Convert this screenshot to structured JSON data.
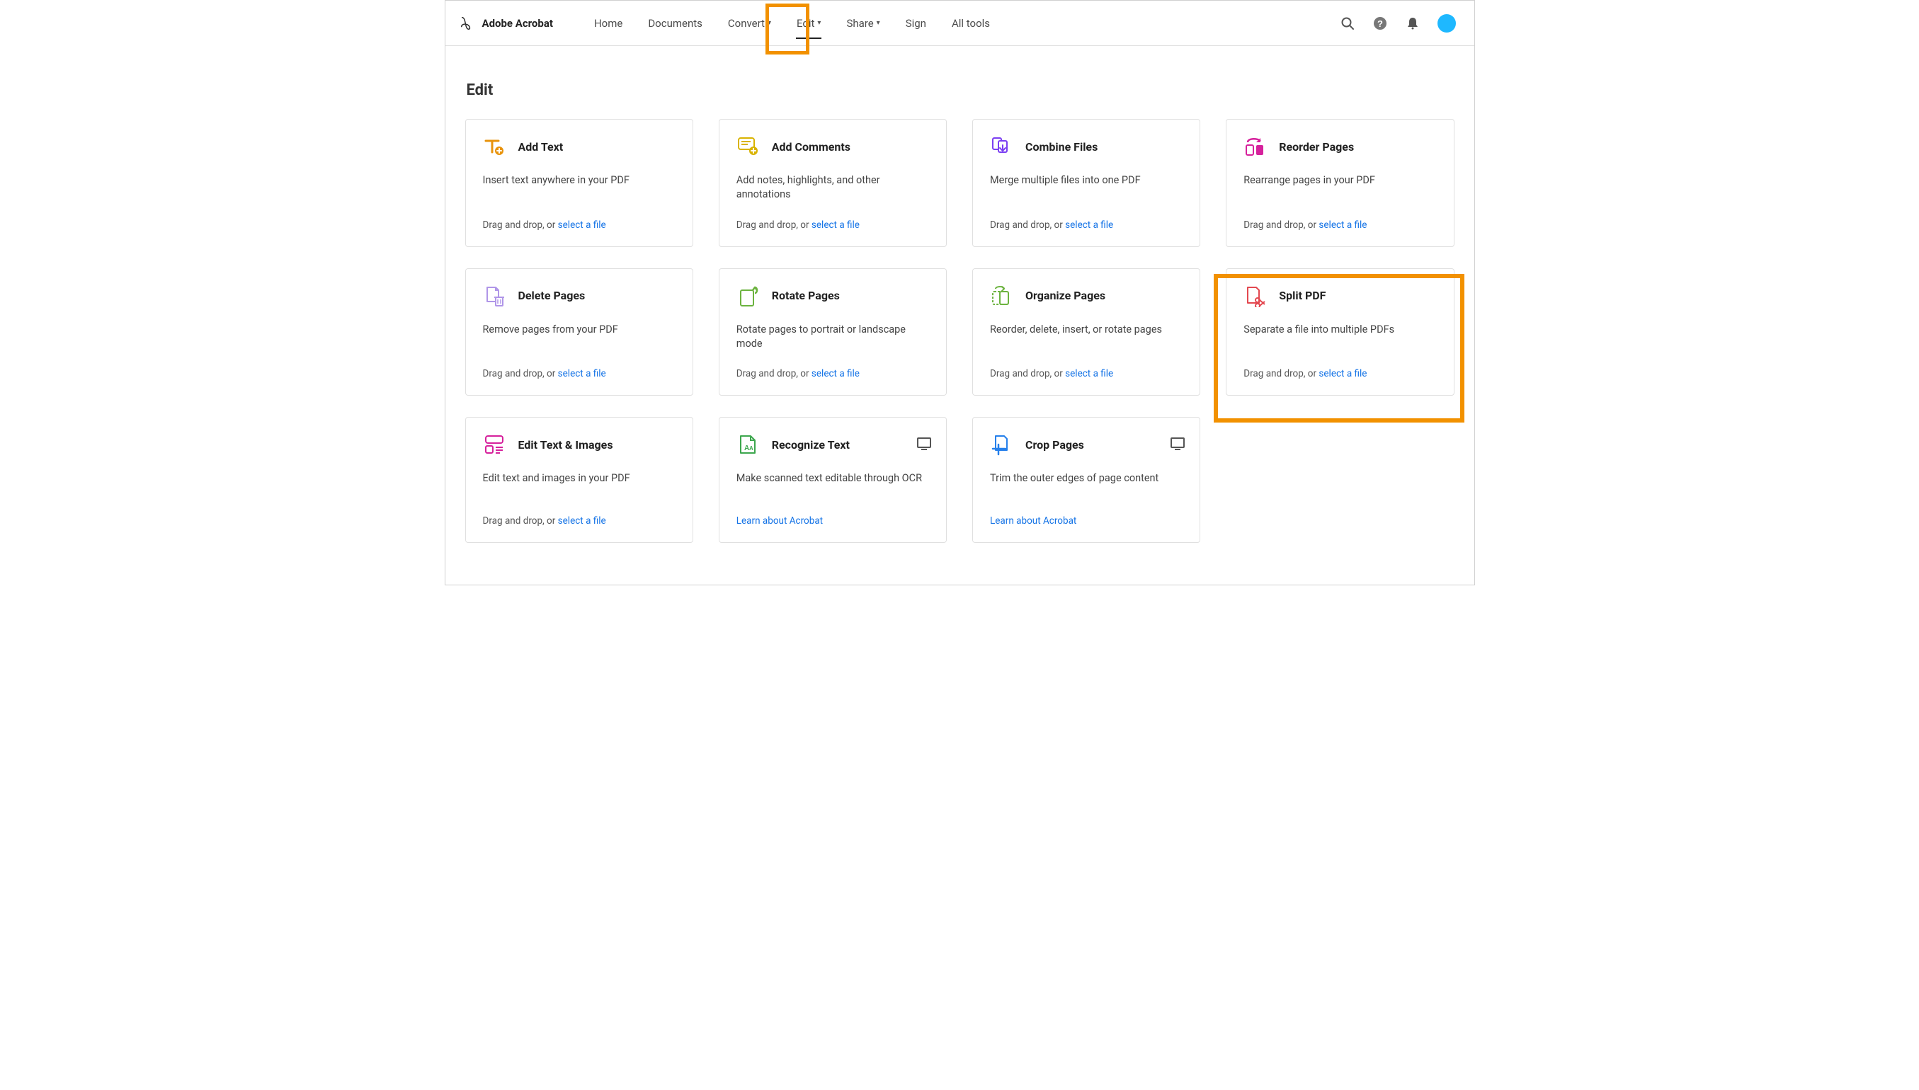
{
  "brand": "Adobe Acrobat",
  "nav": {
    "home": "Home",
    "documents": "Documents",
    "convert": "Convert",
    "edit": "Edit",
    "share": "Share",
    "sign": "Sign",
    "all_tools": "All tools"
  },
  "page_title": "Edit",
  "drop_prefix": "Drag and drop, or ",
  "select_file": "select a file",
  "learn_link": "Learn about Acrobat",
  "cards": {
    "add_text": {
      "title": "Add Text",
      "desc": "Insert text anywhere in your PDF"
    },
    "add_comments": {
      "title": "Add Comments",
      "desc": "Add notes, highlights, and other annotations"
    },
    "combine": {
      "title": "Combine Files",
      "desc": "Merge multiple files into one PDF"
    },
    "reorder": {
      "title": "Reorder Pages",
      "desc": "Rearrange pages in your PDF"
    },
    "delete": {
      "title": "Delete Pages",
      "desc": "Remove pages from your PDF"
    },
    "rotate": {
      "title": "Rotate Pages",
      "desc": "Rotate pages to portrait or landscape mode"
    },
    "organize": {
      "title": "Organize Pages",
      "desc": "Reorder, delete, insert, or rotate pages"
    },
    "split": {
      "title": "Split PDF",
      "desc": "Separate a file into multiple PDFs"
    },
    "edit_ti": {
      "title": "Edit Text & Images",
      "desc": "Edit text and images in your PDF"
    },
    "recognize": {
      "title": "Recognize Text",
      "desc": "Make scanned text editable through OCR"
    },
    "crop": {
      "title": "Crop Pages",
      "desc": "Trim the outer edges of page content"
    }
  }
}
